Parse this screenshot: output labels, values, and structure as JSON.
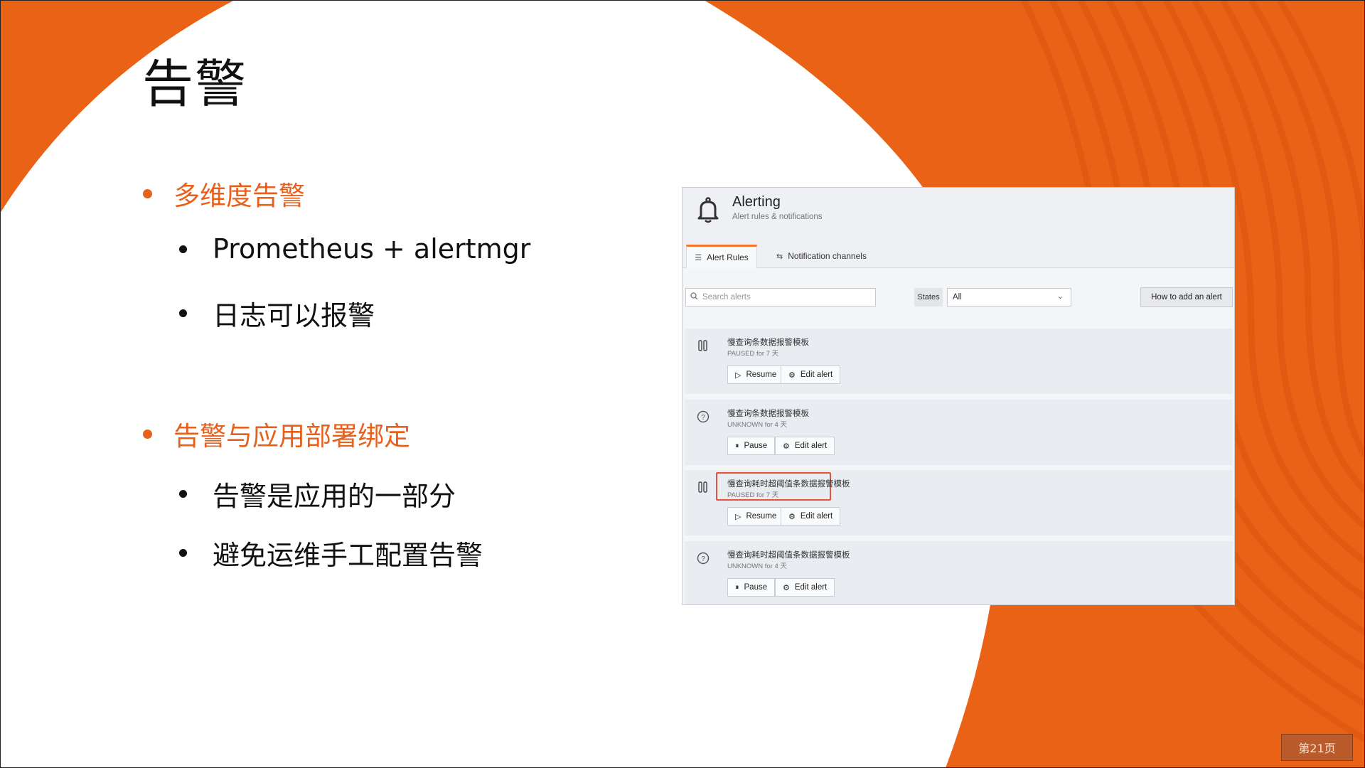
{
  "slide": {
    "title": "告警",
    "bullets": [
      {
        "text": "多维度告警",
        "subs": [
          "Prometheus + alertmgr",
          "日志可以报警"
        ]
      },
      {
        "text": "告警与应用部署绑定",
        "subs": [
          "告警是应用的一部分",
          "避免运维手工配置告警"
        ]
      }
    ],
    "page_number": "第21页"
  },
  "colors": {
    "accent": "#e8601c",
    "highlight": "#e5533c"
  },
  "alerting": {
    "title": "Alerting",
    "subtitle": "Alert rules & notifications",
    "icon": "bell-icon",
    "tabs": [
      {
        "label": "Alert Rules",
        "icon": "list-icon",
        "active": true
      },
      {
        "label": "Notification channels",
        "icon": "channels-icon",
        "active": false
      }
    ],
    "search_placeholder": "Search alerts",
    "states_label": "States",
    "states_value": "All",
    "how_to_label": "How to add an alert",
    "rules": [
      {
        "name": "慢查询条数据报警模板",
        "status": "PAUSED for 7 天",
        "state_icon": "pause-icon",
        "primary_action": "Resume",
        "primary_icon": "play-icon",
        "edit_label": "Edit alert"
      },
      {
        "name": "慢查询条数据报警模板",
        "status": "UNKNOWN for 4 天",
        "state_icon": "question-icon",
        "primary_action": "Pause",
        "primary_icon": "pause-icon",
        "edit_label": "Edit alert"
      },
      {
        "name": "慢查询耗时超阈值条数据报警模板",
        "status": "PAUSED for 7 天",
        "state_icon": "pause-icon",
        "primary_action": "Resume",
        "primary_icon": "play-icon",
        "edit_label": "Edit alert",
        "highlighted": true
      },
      {
        "name": "慢查询耗时超阈值条数据报警模板",
        "status": "UNKNOWN for 4 天",
        "state_icon": "question-icon",
        "primary_action": "Pause",
        "primary_icon": "pause-icon",
        "edit_label": "Edit alert"
      }
    ]
  }
}
